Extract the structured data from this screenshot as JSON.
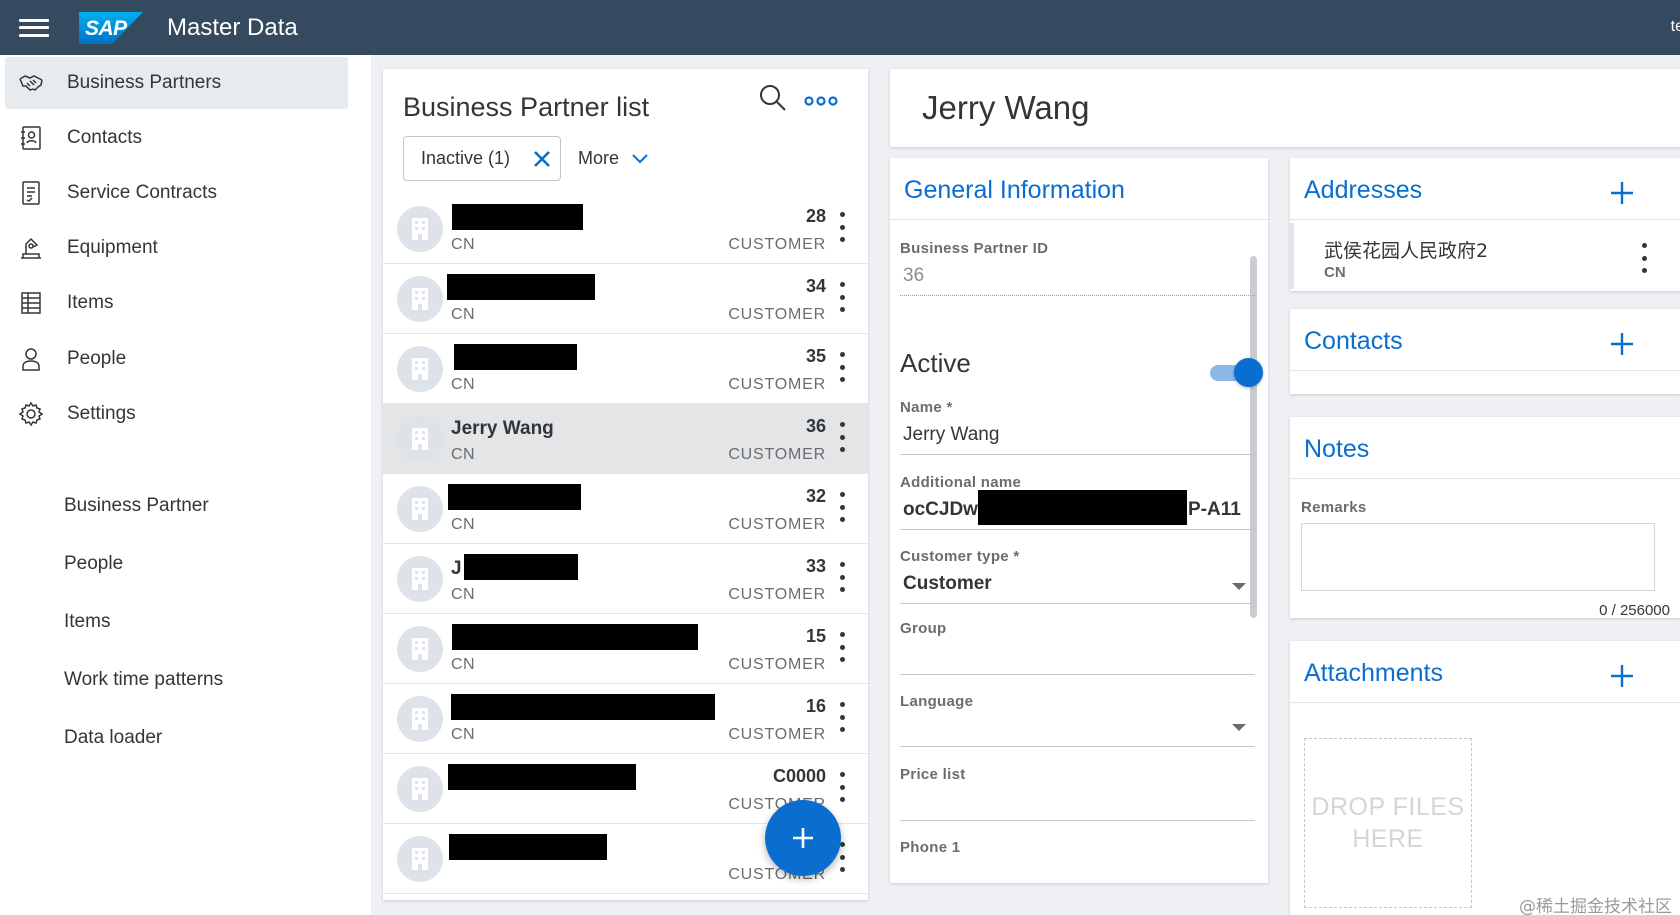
{
  "header": {
    "logo_text": "SAP",
    "app_title": "Master Data",
    "user_partial": "te"
  },
  "sidebar": {
    "items": [
      {
        "label": "Business Partners",
        "icon": "handshake-icon",
        "selected": true
      },
      {
        "label": "Contacts",
        "icon": "address-book-icon"
      },
      {
        "label": "Service Contracts",
        "icon": "contract-icon"
      },
      {
        "label": "Equipment",
        "icon": "equipment-icon"
      },
      {
        "label": "Items",
        "icon": "product-list-icon"
      },
      {
        "label": "People",
        "icon": "person-icon"
      },
      {
        "label": "Settings",
        "icon": "gear-icon"
      }
    ],
    "settings_sub": [
      {
        "label": "Business Partner"
      },
      {
        "label": "People"
      },
      {
        "label": "Items"
      },
      {
        "label": "Work time patterns"
      },
      {
        "label": "Data loader"
      }
    ]
  },
  "list": {
    "title": "Business Partner list",
    "filter_chip": "Inactive (1)",
    "more_label": "More",
    "rows": [
      {
        "name": "",
        "redacted": true,
        "country": "CN",
        "number": "28",
        "type": "CUSTOMER"
      },
      {
        "name": "",
        "redacted": true,
        "country": "CN",
        "number": "34",
        "type": "CUSTOMER"
      },
      {
        "name": "",
        "redacted": true,
        "country": "CN",
        "number": "35",
        "type": "CUSTOMER"
      },
      {
        "name": "Jerry Wang",
        "redacted": false,
        "country": "CN",
        "number": "36",
        "type": "CUSTOMER",
        "selected": true
      },
      {
        "name": "",
        "redacted": true,
        "country": "CN",
        "number": "32",
        "type": "CUSTOMER"
      },
      {
        "name": "J",
        "redacted": true,
        "country": "CN",
        "number": "33",
        "type": "CUSTOMER"
      },
      {
        "name": "",
        "redacted": true,
        "country": "CN",
        "number": "15",
        "type": "CUSTOMER"
      },
      {
        "name": "",
        "redacted": true,
        "country": "CN",
        "number": "16",
        "type": "CUSTOMER"
      },
      {
        "name": "",
        "redacted": true,
        "country": "",
        "number": "C0000",
        "type": "CUSTOMER"
      },
      {
        "name": "",
        "redacted": true,
        "country": "",
        "number": "",
        "type": "CUSTOMER"
      }
    ]
  },
  "detail": {
    "title": "Jerry Wang",
    "general": {
      "section_title": "General Information",
      "bp_id_label": "Business Partner ID",
      "bp_id_value": "36",
      "active_label": "Active",
      "active": true,
      "name_label": "Name *",
      "name_value": "Jerry Wang",
      "additional_name_label": "Additional name",
      "additional_name_prefix": "ocCJDw",
      "additional_name_suffix": "P-A11",
      "customer_type_label": "Customer type *",
      "customer_type_value": "Customer",
      "group_label": "Group",
      "language_label": "Language",
      "price_list_label": "Price list",
      "phone1_label": "Phone 1"
    },
    "addresses": {
      "title": "Addresses",
      "items": [
        {
          "line": "武侯花园人民政府2",
          "country": "CN"
        }
      ]
    },
    "contacts": {
      "title": "Contacts"
    },
    "notes": {
      "title": "Notes",
      "remarks_label": "Remarks",
      "remarks_value": "",
      "remarks_count": "0 / 256000"
    },
    "attachments": {
      "title": "Attachments",
      "drop_text_line1": "DROP FILES",
      "drop_text_line2": "HERE"
    }
  },
  "watermark": "@稀土掘金技术社区",
  "colors": {
    "shell_header": "#354a5f",
    "accent": "#0a6ed1",
    "text": "#32363a",
    "muted": "#6a6d70",
    "background": "#eef0f3"
  }
}
